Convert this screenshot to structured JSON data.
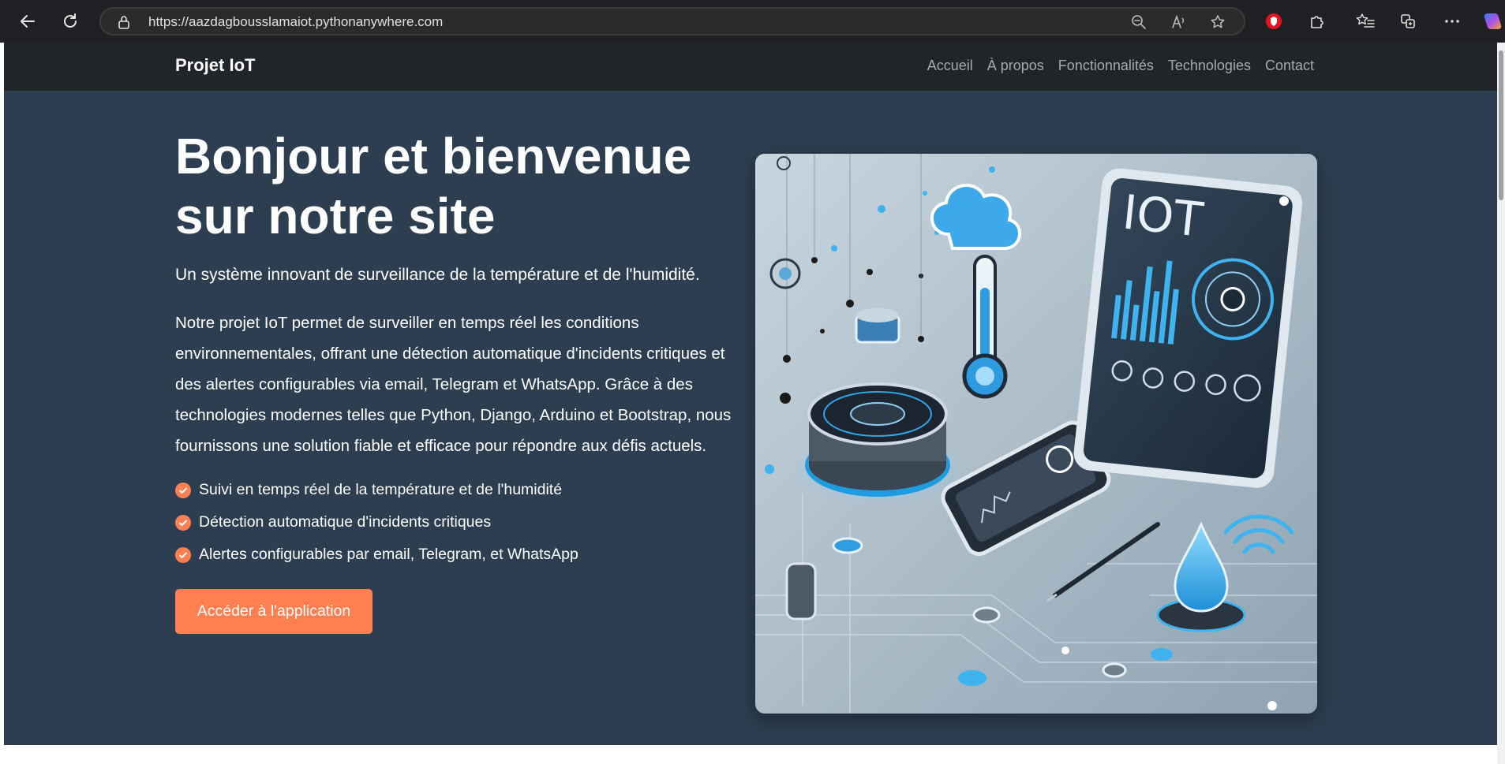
{
  "browser": {
    "url": "https://aazdagbousslamaiot.pythonanywhere.com",
    "back_icon": "back-arrow-icon",
    "refresh_icon": "refresh-icon",
    "lock_icon": "lock-icon",
    "zoom_icon": "zoom-out-icon",
    "read_aloud_icon": "read-aloud-icon",
    "favorite_icon": "star-icon",
    "extension_icons": [
      "shield-extension-icon",
      "puzzle-extensions-icon",
      "favorites-list-icon",
      "collections-icon",
      "more-menu-icon",
      "copilot-icon"
    ]
  },
  "site": {
    "brand": "Projet IoT",
    "nav": [
      "Accueil",
      "À propos",
      "Fonctionnalités",
      "Technologies",
      "Contact"
    ]
  },
  "hero": {
    "title": "Bonjour et bienvenue sur notre site",
    "lead": "Un système innovant de surveillance de la température et de l'humidité.",
    "body": "Notre projet IoT permet de surveiller en temps réel les conditions environnementales, offrant une détection automatique d'incidents critiques et des alertes configurables via email, Telegram et WhatsApp. Grâce à des technologies modernes telles que Python, Django, Arduino et Bootstrap, nous fournissons une solution fiable et efficace pour répondre aux défis actuels.",
    "features": [
      "Suivi en temps réel de la température et de l'humidité",
      "Détection automatique d'incidents critiques",
      "Alertes configurables par email, Telegram, et WhatsApp"
    ],
    "cta": "Accéder à l'application",
    "image_label": "IOT"
  },
  "colors": {
    "accent": "#ff7f50",
    "hero_bg": "#2c3e50",
    "navbar_bg": "#212529"
  }
}
